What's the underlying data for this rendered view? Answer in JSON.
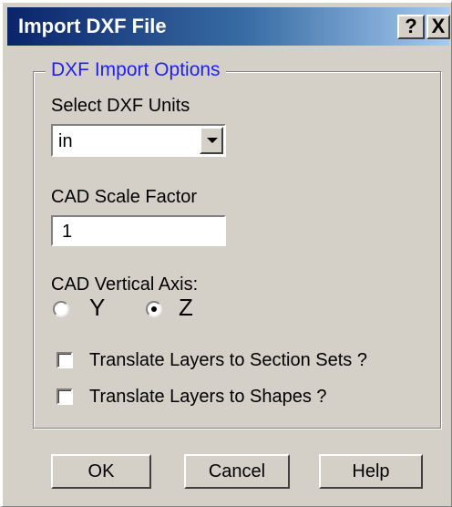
{
  "window": {
    "title": "Import DXF File",
    "help_glyph": "?",
    "close_glyph": "X"
  },
  "group": {
    "legend": "DXF Import Options"
  },
  "units": {
    "label": "Select DXF Units",
    "selected": "in"
  },
  "scale": {
    "label": "CAD Scale Factor",
    "value": "1"
  },
  "vertical_axis": {
    "label": "CAD Vertical Axis:",
    "options": [
      "Y",
      "Z"
    ],
    "selected": "Z"
  },
  "checkboxes": [
    {
      "label": "Translate Layers to Section Sets ?",
      "checked": false
    },
    {
      "label": "Translate Layers to Shapes ?",
      "checked": false
    }
  ],
  "buttons": {
    "ok": "OK",
    "cancel": "Cancel",
    "help": "Help"
  },
  "colors": {
    "legend": "#1f1ff0",
    "title_bar": "#0a246a",
    "face": "#d4d0c8"
  },
  "icons": {
    "dropdown": "chevron-down-icon",
    "help": "question-icon",
    "close": "close-icon"
  }
}
